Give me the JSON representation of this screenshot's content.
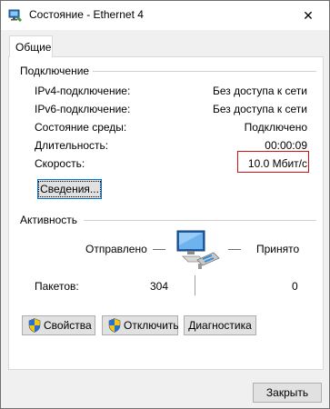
{
  "window": {
    "title": "Состояние - Ethernet 4",
    "close_symbol": "✕"
  },
  "tabs": [
    {
      "label": "Общие"
    }
  ],
  "connection": {
    "group_label": "Подключение",
    "rows": [
      {
        "label": "IPv4-подключение:",
        "value": "Без доступа к сети"
      },
      {
        "label": "IPv6-подключение:",
        "value": "Без доступа к сети"
      },
      {
        "label": "Состояние среды:",
        "value": "Подключено"
      },
      {
        "label": "Длительность:",
        "value": "00:00:09"
      },
      {
        "label": "Скорость:",
        "value": "10.0 Мбит/с"
      }
    ],
    "details_button": "Сведения..."
  },
  "activity": {
    "group_label": "Активность",
    "sent_label": "Отправлено",
    "received_label": "Принято",
    "packets_label": "Пакетов:",
    "packets_sent": "304",
    "packets_received": "0"
  },
  "actions": {
    "properties": "Свойства",
    "disable": "Отключить",
    "diagnose": "Диагностика"
  },
  "footer": {
    "close_button": "Закрыть"
  },
  "colors": {
    "highlight": "#d01010",
    "focus": "#0078d7",
    "window_bg": "#f0f0f0"
  },
  "icons": {
    "title": "network-adapter-icon",
    "activity": "network-computer-icon",
    "shield": "uac-shield-icon"
  }
}
